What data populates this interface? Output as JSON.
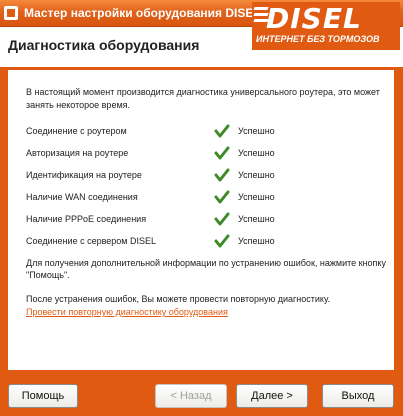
{
  "window": {
    "title": "Мастер настройки оборудования DISEL"
  },
  "header": {
    "title": "Диагностика оборудования",
    "logo_main": "DISEL",
    "logo_sub": "ИНТЕРНЕТ БЕЗ ТОРМОЗОВ"
  },
  "content": {
    "intro": "В настоящий момент производится диагностика универсального роутера, это может занять некоторое время.",
    "checks": [
      {
        "label": "Соединение с роутером",
        "status": "Успешно"
      },
      {
        "label": "Авторизация на роутере",
        "status": "Успешно"
      },
      {
        "label": "Идентификация на роутере",
        "status": "Успешно"
      },
      {
        "label": "Наличие WAN соединения",
        "status": "Успешно"
      },
      {
        "label": "Наличие PPPoE соединения",
        "status": "Успешно"
      },
      {
        "label": "Соединение с сервером DISEL",
        "status": "Успешно"
      }
    ],
    "help_text": "Для получения дополнительной информации по устранению ошибок, нажмите кнопку \"Помощь\".",
    "after_text": "После устранения ошибок, Вы можете провести повторную диагностику.",
    "rerun_link": "Провести повторную диагностику оборудования"
  },
  "buttons": {
    "help": "Помощь",
    "back": "< Назад",
    "next": "Далее >",
    "exit": "Выход"
  },
  "colors": {
    "accent": "#E05A12",
    "check": "#3E8A2A"
  }
}
